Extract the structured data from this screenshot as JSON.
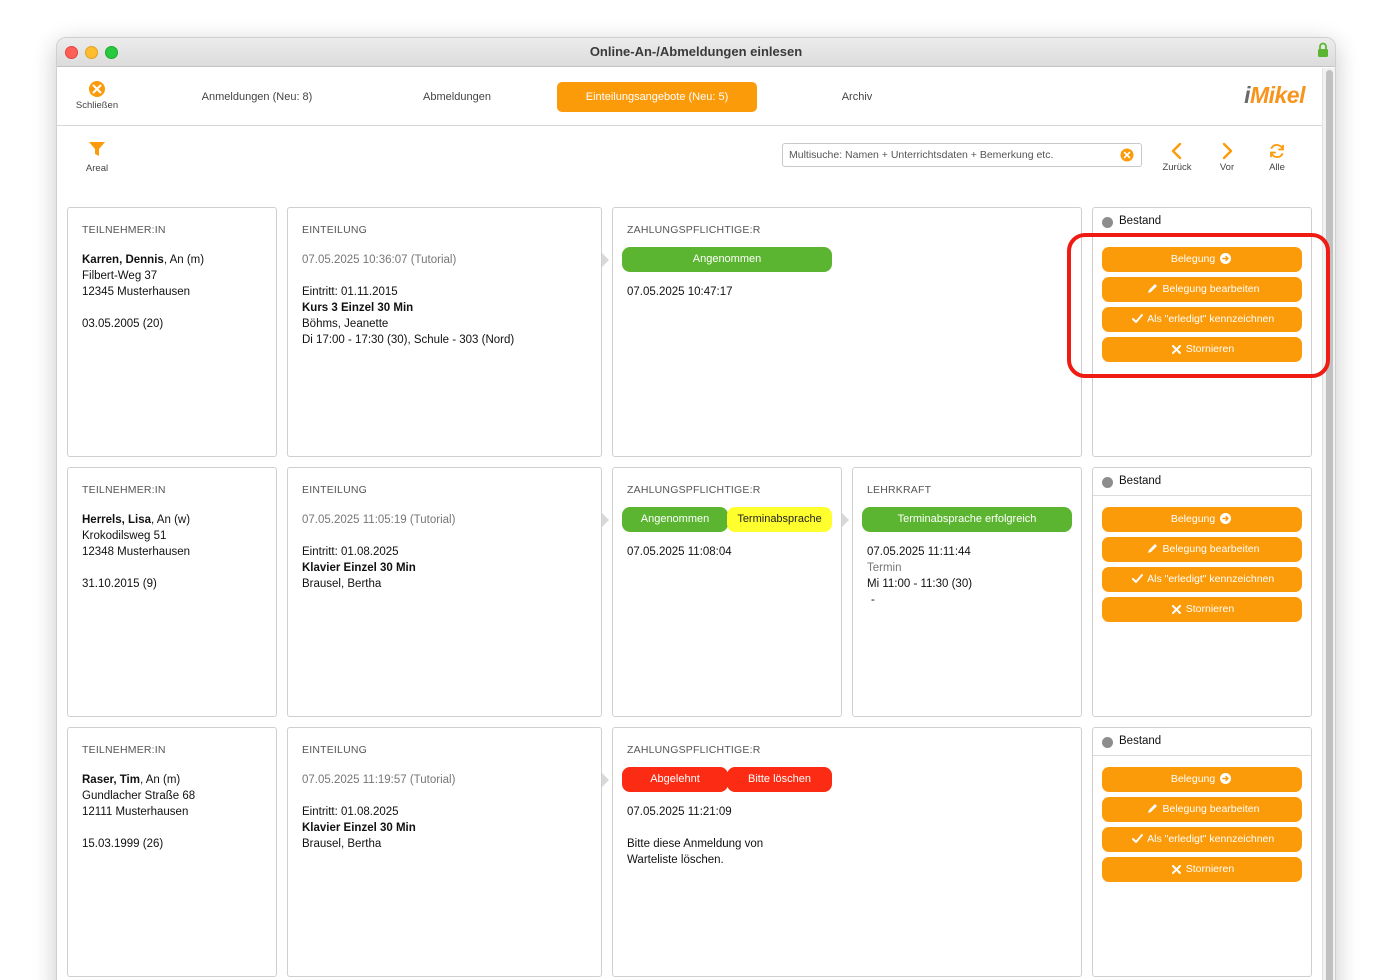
{
  "window": {
    "title": "Online-An-/Abmeldungen einlesen"
  },
  "toolbar": {
    "close_label": "Schließen",
    "tabs": [
      {
        "label": "Anmeldungen (Neu: 8)"
      },
      {
        "label": "Abmeldungen"
      },
      {
        "label": "Einteilungsangebote (Neu: 5)"
      },
      {
        "label": "Archiv"
      }
    ],
    "active_tab": "Einteilungsangebote (Neu: 5)",
    "logo": {
      "prefix": "i",
      "name": "Mikel"
    }
  },
  "filterbar": {
    "areal_label": "Areal",
    "search_placeholder": "Multisuche: Namen + Unterrichtsdaten + Bemerkung etc.",
    "back_label": "Zurück",
    "forward_label": "Vor",
    "all_label": "Alle"
  },
  "colors": {
    "accent": "#fc9b0a",
    "green": "#5cb531",
    "yellow": "#ffff2e",
    "red": "#fb2b14",
    "highlight": "#ee1c12"
  },
  "labels": {
    "participant": "TEILNEHMER:IN",
    "assignment": "EINTEILUNG",
    "payer": "ZAHLUNGSPFLICHTIGE:R",
    "teacher": "LEHRKRAFT",
    "status": "Bestand",
    "btn_belegung": "Belegung",
    "btn_edit": "Belegung bearbeiten",
    "btn_done": "Als \"erledigt\" kennzeichnen",
    "btn_cancel": "Stornieren"
  },
  "records": [
    {
      "participant": {
        "name": "Karren, Dennis",
        "suffix": ", An (m)",
        "street": "Filbert-Weg 37",
        "city": "12345 Musterhausen",
        "birth": "03.05.2005 (20)"
      },
      "assignment": {
        "timestamp": "07.05.2025 10:36:07 (Tutorial)",
        "entry": "Eintritt: 01.11.2015",
        "course": "Kurs 3 Einzel 30 Min",
        "teacher": "Böhms, Jeanette",
        "schedule": "Di 17:00 - 17:30 (30), Schule - 303 (Nord)"
      },
      "payer": {
        "statuses": [
          "Angenommen"
        ],
        "timestamp": "07.05.2025 10:47:17"
      }
    },
    {
      "participant": {
        "name": "Herrels, Lisa",
        "suffix": ", An (w)",
        "street": "Krokodilsweg 51",
        "city": "12348 Musterhausen",
        "birth": "31.10.2015 (9)"
      },
      "assignment": {
        "timestamp": "07.05.2025 11:05:19 (Tutorial)",
        "entry": "Eintritt: 01.08.2025",
        "course": "Klavier Einzel 30 Min",
        "teacher": "Brausel, Bertha"
      },
      "payer": {
        "statuses": [
          "Angenommen",
          "Terminabsprache"
        ],
        "timestamp": "07.05.2025 11:08:04"
      },
      "teacher": {
        "status": "Terminabsprache erfolgreich",
        "timestamp": "07.05.2025 11:11:44",
        "label": "Termin",
        "slot": "Mi 11:00 - 11:30 (30)",
        "extra": "-"
      }
    },
    {
      "participant": {
        "name": "Raser, Tim",
        "suffix": ", An (m)",
        "street": "Gundlacher Straße 68",
        "city": "12111 Musterhausen",
        "birth": "15.03.1999 (26)"
      },
      "assignment": {
        "timestamp": "07.05.2025 11:19:57 (Tutorial)",
        "entry": "Eintritt: 01.08.2025",
        "course": "Klavier Einzel 30 Min",
        "teacher": "Brausel, Bertha"
      },
      "payer": {
        "statuses": [
          "Abgelehnt",
          "Bitte löschen"
        ],
        "timestamp": "07.05.2025 11:21:09",
        "note_line1": "Bitte diese Anmeldung von",
        "note_line2": "Warteliste löschen."
      }
    }
  ]
}
